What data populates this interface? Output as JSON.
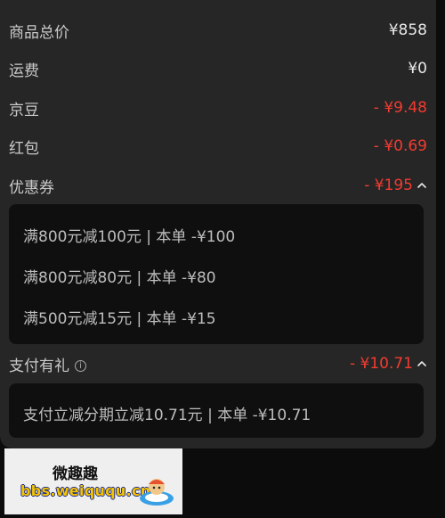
{
  "summary": {
    "items": [
      {
        "label": "商品总价",
        "value": "¥858"
      },
      {
        "label": "运费",
        "value": "¥0"
      },
      {
        "label": "京豆",
        "value": "- ¥9.48"
      },
      {
        "label": "红包",
        "value": "- ¥0.69"
      }
    ]
  },
  "coupons": {
    "label": "优惠券",
    "value": "- ¥195",
    "lines": [
      "满800元减100元 | 本单 -¥100",
      "满800元减80元 | 本单 -¥80",
      "满500元减15元 | 本单 -¥15"
    ]
  },
  "payment_gift": {
    "label": "支付有礼",
    "info_icon": "i",
    "value": "- ¥10.71",
    "lines": [
      "支付立减分期立减10.71元 | 本单 -¥10.71"
    ]
  },
  "watermark": {
    "title": "微趣趣",
    "url": "bbs.weiququ.cn"
  },
  "colors": {
    "panel": "#262626",
    "box": "#0f0f0f",
    "discount_red": "#f23b30",
    "label_gray": "#c9c9c9"
  }
}
